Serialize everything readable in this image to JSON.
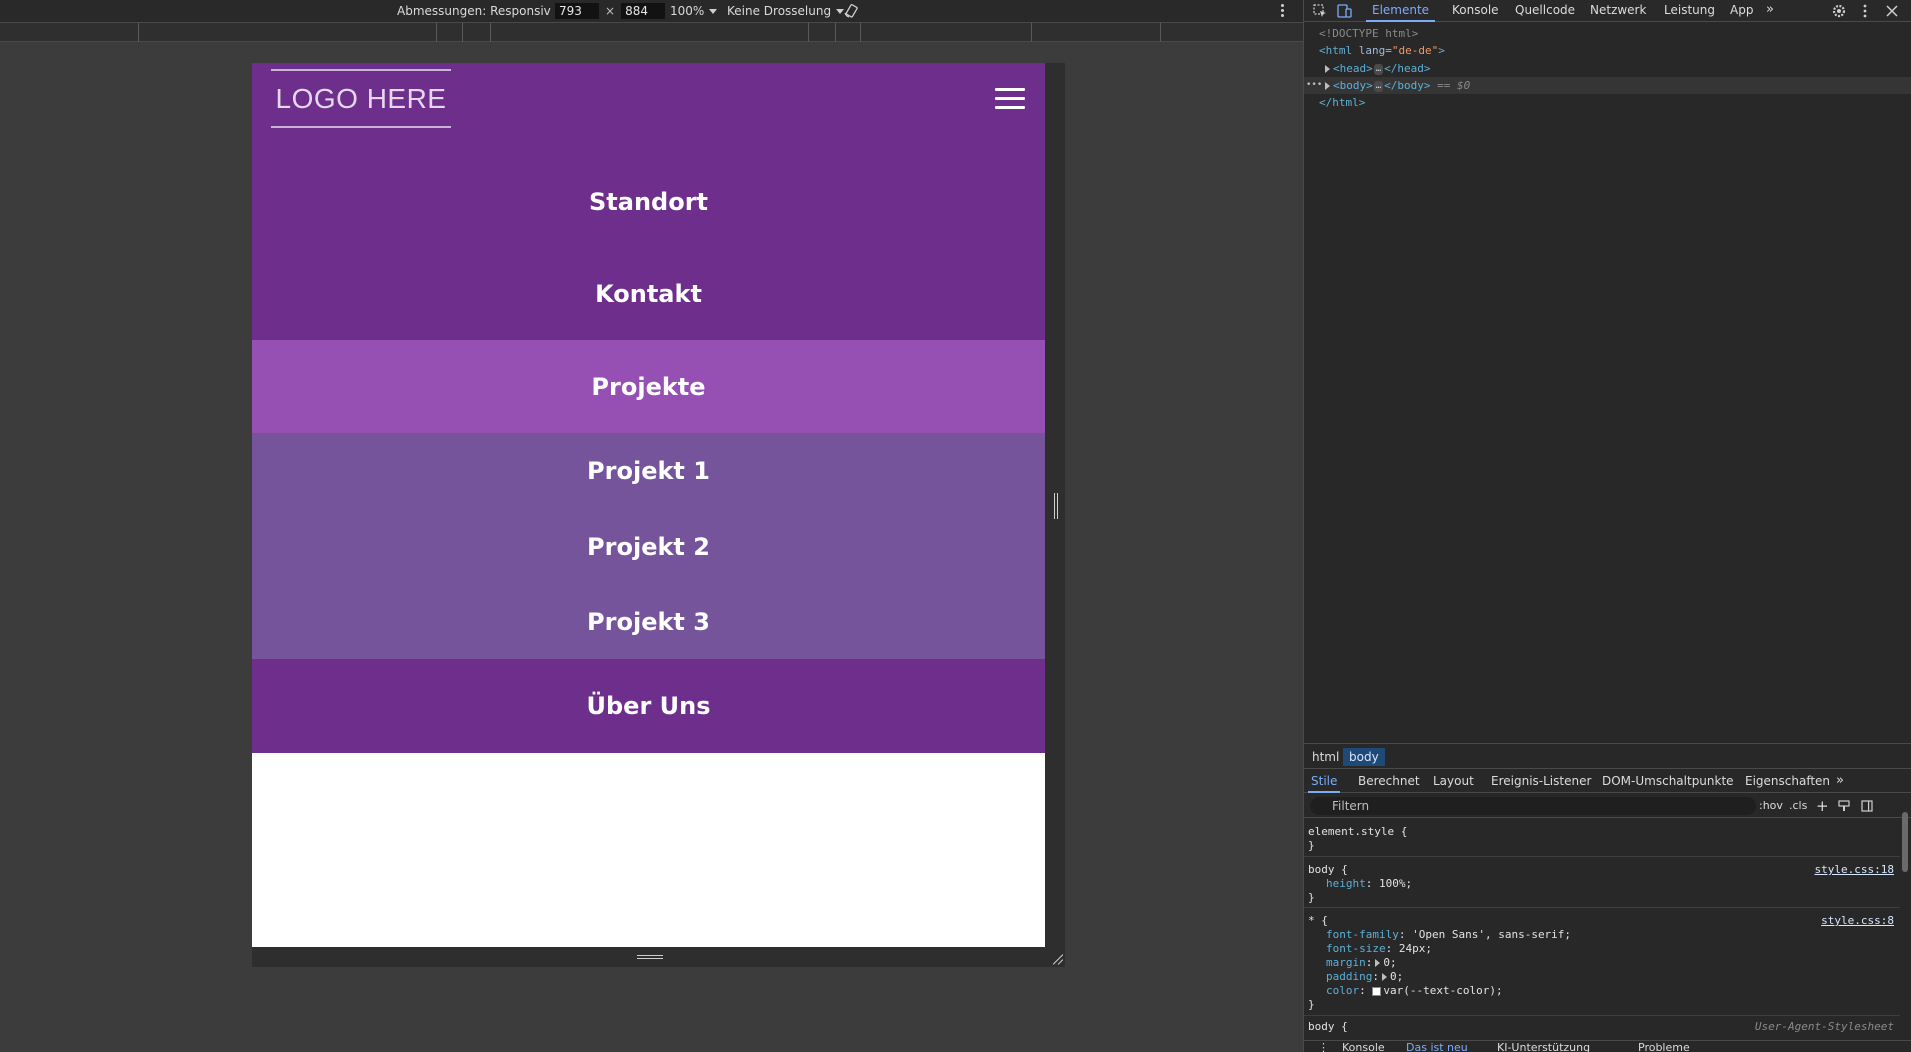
{
  "emulation": {
    "dimensions_label": "Abmessungen: Responsiv",
    "width_value": "793",
    "height_value": "884",
    "times_sign": "×",
    "zoom": "100%",
    "throttling": "Keine Drosselung"
  },
  "site": {
    "logo": "LOGO HERE",
    "nav": [
      {
        "label": "Standort",
        "state": "default"
      },
      {
        "label": "Kontakt",
        "state": "default"
      },
      {
        "label": "Projekte",
        "state": "active"
      },
      {
        "label": "Projekt 1",
        "state": "submenu"
      },
      {
        "label": "Projekt 2",
        "state": "submenu"
      },
      {
        "label": "Projekt 3",
        "state": "submenu"
      },
      {
        "label": "Über Uns",
        "state": "default"
      }
    ],
    "colors": {
      "header": "#6e2f8c",
      "active": "#9650b4",
      "submenu": "#76549c",
      "text": "#ffffff"
    }
  },
  "devtools": {
    "tabs": [
      "Elemente",
      "Konsole",
      "Quellcode",
      "Netzwerk",
      "Leistung",
      "App"
    ],
    "active_tab": "Elemente",
    "more": "»",
    "dom": {
      "doctype": "<!DOCTYPE html>",
      "html_open_tag": "<html",
      "html_attr": "lang",
      "html_attr_value": "\"de-de\"",
      "html_open_close": ">",
      "head_open": "<head>",
      "head_close": "</head>",
      "body_open": "<body>",
      "body_close": "</body>",
      "ellipsis": "…",
      "selected_marker": "== $0",
      "html_close": "</html>",
      "row_dots": "•••"
    },
    "breadcrumbs": [
      "html",
      "body"
    ],
    "style_tabs": [
      "Stile",
      "Berechnet",
      "Layout",
      "Ereignis-Listener",
      "DOM-Umschaltpunkte",
      "Eigenschaften"
    ],
    "filter_placeholder": "Filtern",
    "filter_buttons": [
      ":hov",
      ".cls",
      "+"
    ],
    "styles": {
      "element_style": "element.style {",
      "close_brace": "}",
      "body_rule": {
        "selector": "body {",
        "source": "style.css:18",
        "props": [
          {
            "name": "height",
            "value": "100%;"
          }
        ]
      },
      "star_rule": {
        "selector": "* {",
        "source": "style.css:8",
        "props": [
          {
            "name": "font-family",
            "value": "'Open Sans', sans-serif;"
          },
          {
            "name": "font-size",
            "value": "24px;"
          },
          {
            "name": "margin",
            "value": "0;"
          },
          {
            "name": "padding",
            "value": "0;"
          },
          {
            "name": "color",
            "value": "var(--text-color);"
          }
        ]
      },
      "ua_rule": {
        "selector": "body {",
        "source": "User-Agent-Stylesheet"
      }
    },
    "drawer_tabs": [
      "Konsole",
      "Das ist neu",
      "KI-Unterstützung",
      "Probleme"
    ]
  }
}
